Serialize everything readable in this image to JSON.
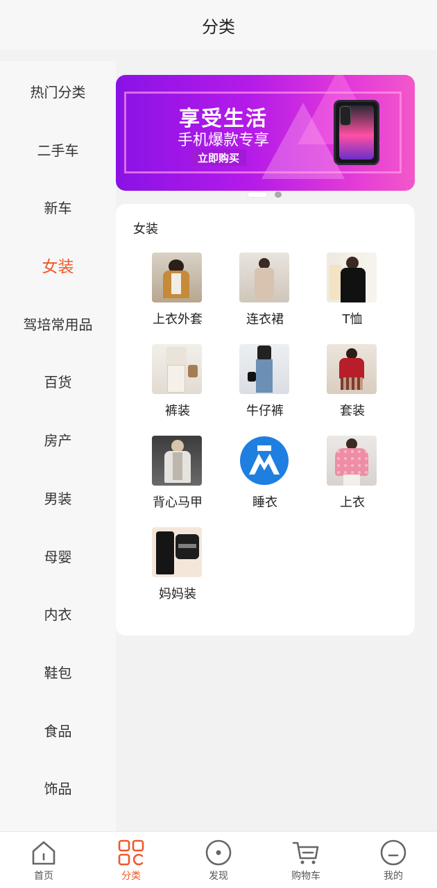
{
  "header": {
    "title": "分类"
  },
  "sidebar": {
    "items": [
      {
        "label": "热门分类"
      },
      {
        "label": "二手车"
      },
      {
        "label": "新车"
      },
      {
        "label": "女装",
        "active": true
      },
      {
        "label": "驾培常用品"
      },
      {
        "label": "百货"
      },
      {
        "label": "房产"
      },
      {
        "label": "男装"
      },
      {
        "label": "母婴"
      },
      {
        "label": "内衣"
      },
      {
        "label": "鞋包"
      },
      {
        "label": "食品"
      },
      {
        "label": "饰品"
      }
    ]
  },
  "banner": {
    "title": "享受生活",
    "subtitle": "手机爆款专享",
    "button": "立即购买",
    "slide_count": 2,
    "active_slide": 0
  },
  "category": {
    "title": "女装",
    "items": [
      {
        "label": "上衣外套",
        "thumb": "brown-coat"
      },
      {
        "label": "连衣裙",
        "thumb": "dress"
      },
      {
        "label": "T恤",
        "thumb": "black-turtleneck"
      },
      {
        "label": "裤装",
        "thumb": "white-pants"
      },
      {
        "label": "牛仔裤",
        "thumb": "jeans"
      },
      {
        "label": "套装",
        "thumb": "red-suit"
      },
      {
        "label": "背心马甲",
        "thumb": "vest"
      },
      {
        "label": "睡衣",
        "thumb": "blue-logo"
      },
      {
        "label": "上衣",
        "thumb": "pink-sweater"
      },
      {
        "label": "妈妈装",
        "thumb": "black-set"
      }
    ]
  },
  "tabbar": {
    "items": [
      {
        "label": "首页",
        "icon": "home-icon"
      },
      {
        "label": "分类",
        "icon": "grid-icon",
        "active": true
      },
      {
        "label": "发现",
        "icon": "compass-icon"
      },
      {
        "label": "购物车",
        "icon": "cart-icon"
      },
      {
        "label": "我的",
        "icon": "profile-icon"
      }
    ]
  },
  "colors": {
    "accent": "#f0582a",
    "banner_start": "#8a12e6",
    "banner_end": "#f358c9"
  }
}
